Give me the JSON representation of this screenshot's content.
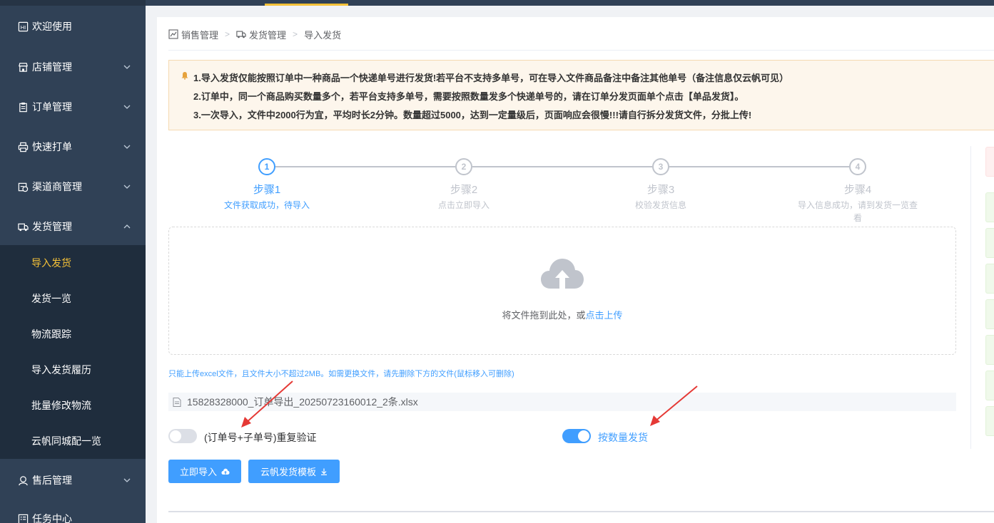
{
  "sidebar": {
    "items": [
      {
        "label": "欢迎使用",
        "icon": "welcome-icon",
        "expandable": false
      },
      {
        "label": "店铺管理",
        "icon": "shop-icon",
        "expandable": true
      },
      {
        "label": "订单管理",
        "icon": "clipboard-icon",
        "expandable": true
      },
      {
        "label": "快速打单",
        "icon": "printer-icon",
        "expandable": true
      },
      {
        "label": "渠道商管理",
        "icon": "channel-icon",
        "expandable": true
      },
      {
        "label": "发货管理",
        "icon": "truck-icon",
        "expandable": true,
        "expanded": true
      },
      {
        "label": "售后管理",
        "icon": "user-service-icon",
        "expandable": true
      },
      {
        "label": "任务中心",
        "icon": "task-list-icon",
        "expandable": false
      }
    ],
    "sub_items": [
      {
        "label": "导入发货",
        "active": true
      },
      {
        "label": "发货一览",
        "active": false
      },
      {
        "label": "物流跟踪",
        "active": false
      },
      {
        "label": "导入发货履历",
        "active": false
      },
      {
        "label": "批量修改物流",
        "active": false
      },
      {
        "label": "云帆同城配一览",
        "active": false
      }
    ]
  },
  "breadcrumb": [
    "销售管理",
    "发货管理",
    "导入发货"
  ],
  "notice": {
    "lines": [
      "1.导入发货仅能按照订单中一种商品一个快递单号进行发货!若平台不支持多单号，可在导入文件商品备注中备注其他单号（备注信息仅云帆可见）",
      "2.订单中，同一个商品购买数量多个，若平台支持多单号，需要按照数量发多个快递单号的，请在订单分发页面单个点击【单品发货】。",
      "3.一次导入，文件中2000行为宜，平均时长2分钟。数量超过5000，达到一定量级后，页面响应会很慢!!!请自行拆分发货文件，分批上传!"
    ],
    "accent_color": "#e6a23c"
  },
  "steps": [
    {
      "number": "1",
      "title": "步骤1",
      "desc": "文件获取成功，待导入",
      "active": true
    },
    {
      "number": "2",
      "title": "步骤2",
      "desc": "点击立即导入",
      "active": false
    },
    {
      "number": "3",
      "title": "步骤3",
      "desc": "校验发货信息",
      "active": false
    },
    {
      "number": "4",
      "title": "步骤4",
      "desc": "导入信息成功，请到发货一览查看",
      "active": false
    }
  ],
  "upload": {
    "text": "将文件拖到此处，或",
    "link": "点击上传",
    "tip": "只能上传excel文件，且文件大小不超过2MB。如需更换文件，请先删除下方的文件(鼠标移入可删除)",
    "file_name": "15828328000_订单导出_20250723160012_2条.xlsx"
  },
  "switches": {
    "duplicate_check": {
      "label": "(订单号+子单号)重复验证",
      "on": false
    },
    "ship_by_quantity": {
      "label": "按数量发货",
      "on": true
    }
  },
  "buttons": {
    "import_now": "立即导入",
    "template": "云帆发货模板"
  },
  "colors": {
    "sidebar_bg": "#304156",
    "primary": "#409eff",
    "active_menu": "#f4c138",
    "annotation_arrow": "#e53935"
  }
}
